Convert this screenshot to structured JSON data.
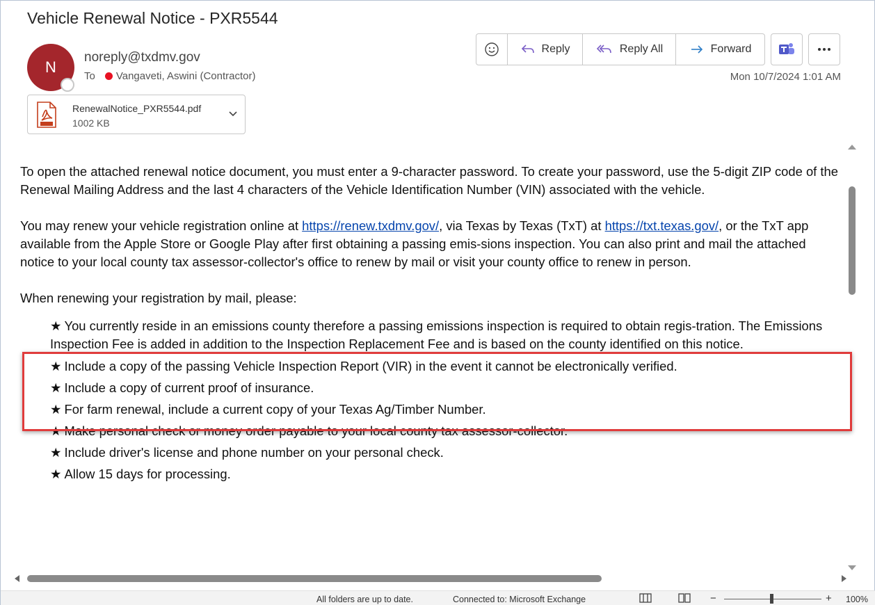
{
  "email": {
    "subject": "Vehicle Renewal Notice - PXR5544",
    "avatar_initial": "N",
    "sender": "noreply@txdmv.gov",
    "to_label": "To",
    "recipient": "Vangaveti, Aswini (Contractor)",
    "datetime": "Mon 10/7/2024 1:01 AM"
  },
  "attachment": {
    "name": "RenewalNotice_PXR5544.pdf",
    "size": "1002 KB",
    "icon": "pdf-icon"
  },
  "toolbar": {
    "emoji_icon": "smiley-icon",
    "reply_label": "Reply",
    "reply_all_label": "Reply All",
    "forward_label": "Forward",
    "teams_icon": "teams-icon",
    "more_icon": "more-icon"
  },
  "body": {
    "p1": "To open the attached renewal notice document, you must enter a 9-character password. To create your password, use the 5-digit ZIP code of the Renewal Mailing Address and the last 4 characters of the Vehicle Identification Number (VIN) associated with the vehicle.",
    "p2_a": "You may renew your vehicle registration online at ",
    "link1": "https://renew.txdmv.gov/",
    "p2_b": ", via Texas by Texas (TxT) at ",
    "link2": "https://txt.texas.gov/",
    "p2_c": ", or the TxT app available from the Apple Store or Google Play after first obtaining a passing emis-sions inspection. You can also print and mail the attached notice to your local county tax assessor-collector's office to renew by mail or visit your county office to renew in person.",
    "p3": "When renewing your registration by mail, please:",
    "bullets": [
      "You currently reside in an emissions county therefore a passing emissions inspection is required to obtain regis-tration. The Emissions Inspection Fee is added in addition to the Inspection Replacement Fee and is based on the county identified on this notice.",
      "Include a copy of the passing Vehicle Inspection Report (VIR) in the event it cannot be electronically verified.",
      "Include a copy of current proof of insurance.",
      "For farm renewal, include a current copy of your Texas Ag/Timber Number.",
      "Make personal check or money order payable to your local county tax assessor-collector.",
      "Include driver's license and phone number on your personal check.",
      "Allow 15 days for processing."
    ],
    "bullet_glyph": "★"
  },
  "status": {
    "folders": "All folders are up to date.",
    "connection": "Connected to: Microsoft Exchange",
    "zoom_minus": "−",
    "zoom_plus": "+",
    "zoom": "100%"
  },
  "colors": {
    "avatar": "#a4262c",
    "highlight_border": "#e03c3c",
    "link": "#0645ad",
    "teams": "#5059c9"
  }
}
